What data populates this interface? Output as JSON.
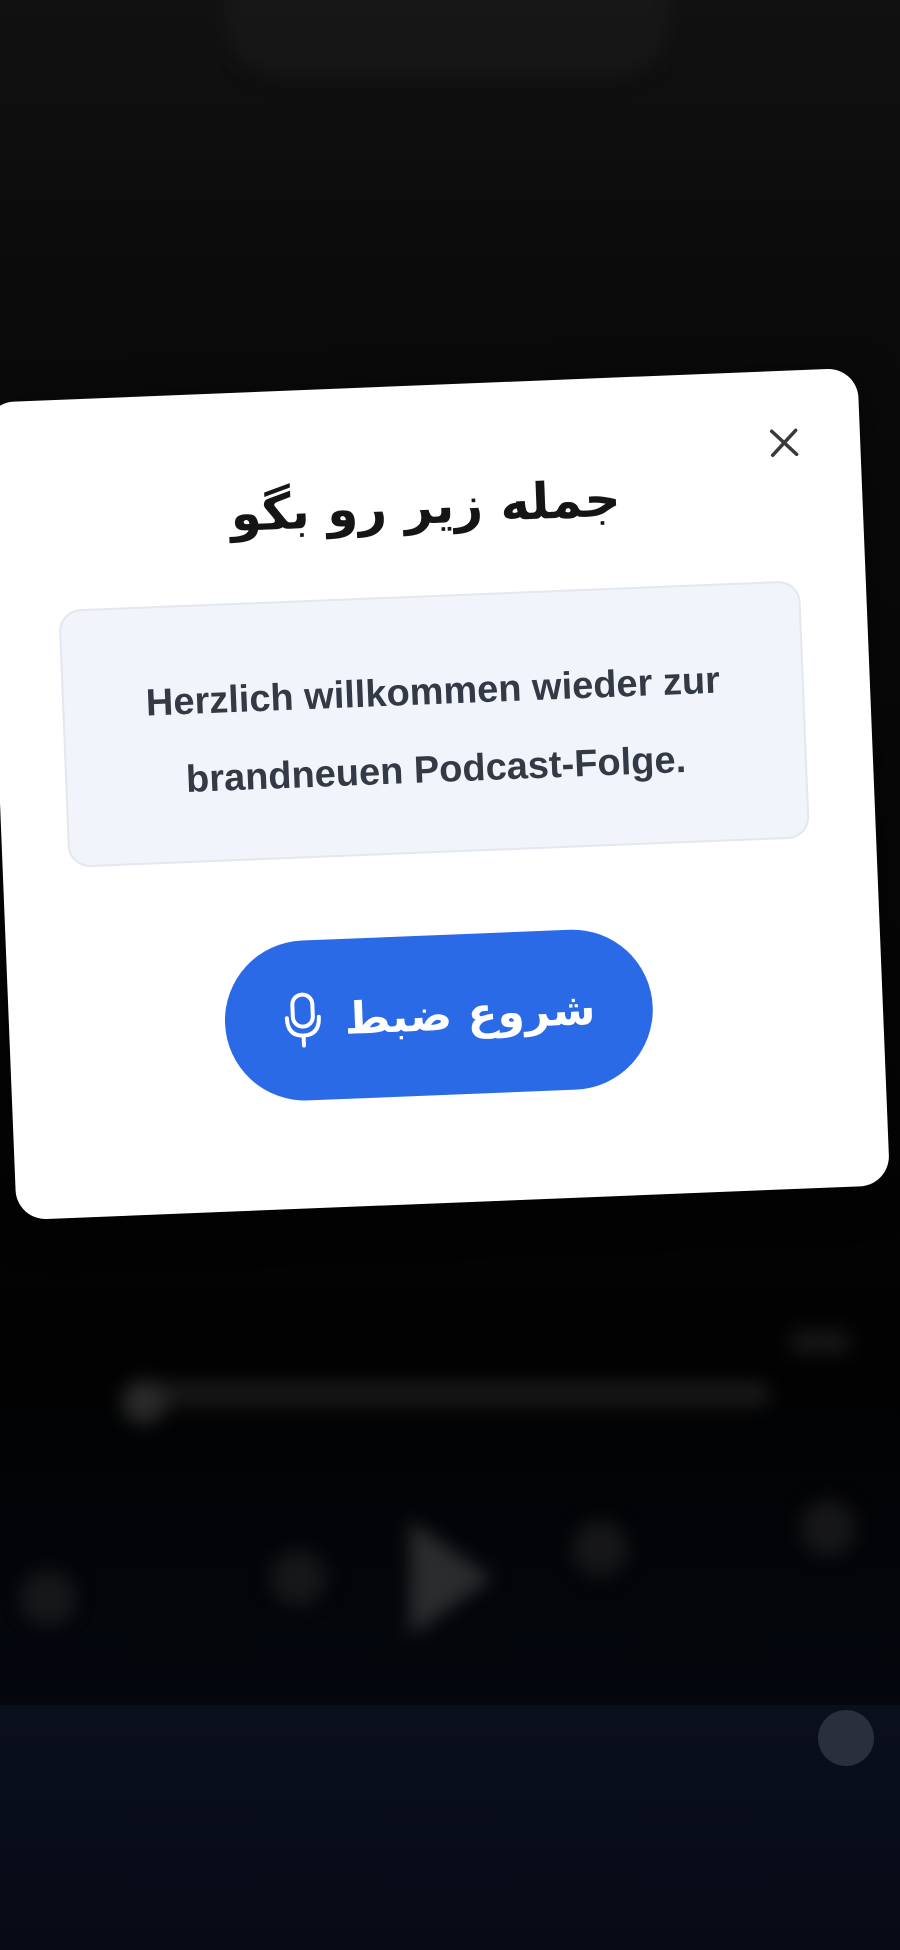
{
  "background": {
    "header_line_1": "",
    "episode_title": "",
    "subtitle": "",
    "info_line": "",
    "label_below": ""
  },
  "modal": {
    "title": "جمله زیر رو بگو",
    "phrase": "Herzlich willkommen wieder zur brandneuen Podcast-Folge.",
    "record_button_label": "شروع ضبط",
    "record_icon": "microphone-icon",
    "close_icon": "close-icon",
    "accent_color": "#2b6ae6"
  }
}
